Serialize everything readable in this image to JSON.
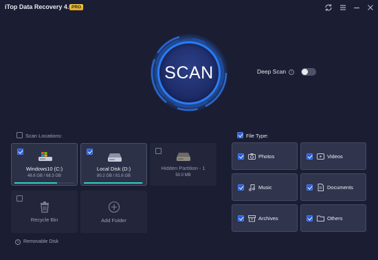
{
  "app": {
    "title": "iTop Data Recovery 4.0",
    "badge": "PRO",
    "window_controls": [
      "refresh-icon",
      "menu-icon",
      "minimize-icon",
      "close-icon"
    ]
  },
  "scan": {
    "label": "SCAN",
    "deep_scan_label": "Deep Scan",
    "deep_scan_info": "i",
    "deep_scan_enabled": false
  },
  "locations": {
    "header": "Scan Locations:",
    "header_checked": false,
    "drives": [
      {
        "name": "Windows10 (C:)",
        "size": "48.6 GB / 68.3 GB",
        "checked": true,
        "usage": 0.71,
        "icon": "windows-drive-icon"
      },
      {
        "name": "Local Disk (D:)",
        "size": "80.2 GB / 81.6 GB",
        "checked": true,
        "usage": 0.98,
        "icon": "hard-drive-icon"
      },
      {
        "name": "Hidden Partition - 1",
        "size": "50.0 MB",
        "checked": false,
        "icon": "hard-drive-icon"
      }
    ],
    "recycle_bin": {
      "label": "Recycle Bin",
      "checked": false,
      "icon": "trash-icon"
    },
    "add_folder": {
      "label": "Add Folder",
      "icon": "plus-icon"
    },
    "removable_disk": {
      "label": "Removable Disk",
      "icon_glyph": "i"
    }
  },
  "file_types": {
    "header": "File Type:",
    "header_checked": true,
    "items": [
      {
        "label": "Photos",
        "checked": true,
        "icon": "camera-icon"
      },
      {
        "label": "Videos",
        "checked": true,
        "icon": "video-icon"
      },
      {
        "label": "Music",
        "checked": true,
        "icon": "music-icon"
      },
      {
        "label": "Documents",
        "checked": true,
        "icon": "document-icon"
      },
      {
        "label": "Archives",
        "checked": true,
        "icon": "archive-icon"
      },
      {
        "label": "Others",
        "checked": true,
        "icon": "folder-icon"
      }
    ]
  },
  "colors": {
    "background": "#1b1e32",
    "card": "#2d3148",
    "accent": "#2a7cf5",
    "usage_bar": "#2ed3c6",
    "badge": "#f2c040"
  }
}
